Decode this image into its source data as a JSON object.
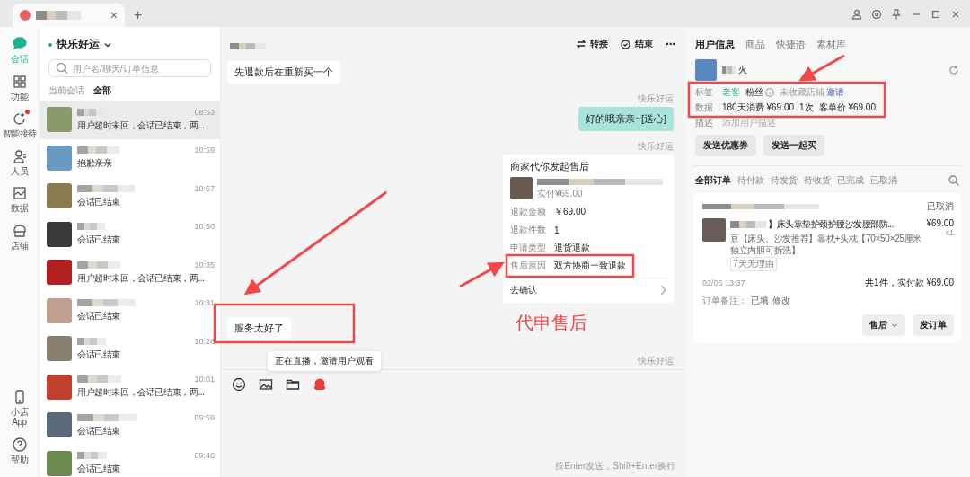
{
  "title_bar": {
    "tab": {
      "close": "×"
    },
    "new_tab": "+"
  },
  "nav": {
    "items": [
      {
        "label": "会话",
        "selected": true,
        "badge": false
      },
      {
        "label": "功能",
        "selected": false,
        "badge": false
      },
      {
        "label": "智能接待",
        "selected": false,
        "badge": true
      },
      {
        "label": "人员",
        "selected": false,
        "badge": false
      },
      {
        "label": "数据",
        "selected": false,
        "badge": false
      },
      {
        "label": "店铺",
        "selected": false,
        "badge": false
      }
    ],
    "bottom": [
      {
        "label": "小店\nApp"
      },
      {
        "label": "帮助"
      }
    ]
  },
  "conversations": {
    "shop_name": "快乐好运",
    "online": true,
    "search": {
      "placeholder": "用户名/聊天/订单信息"
    },
    "filters": [
      {
        "label": "当前会话",
        "selected": false
      },
      {
        "label": "全部",
        "selected": true
      }
    ],
    "items": [
      {
        "time": "08:53",
        "preview": "用户超时未回，会话已结束，两...",
        "selected": true
      },
      {
        "time": "10:59",
        "preview": "抱歉亲亲",
        "selected": false
      },
      {
        "time": "10:57",
        "preview": "会话已结束",
        "selected": false
      },
      {
        "time": "10:50",
        "preview": "会话已结束",
        "selected": false
      },
      {
        "time": "10:35",
        "preview": "用户超时未回，会话已结束，两...",
        "selected": false
      },
      {
        "time": "10:31",
        "preview": "会话已结束",
        "selected": false
      },
      {
        "time": "10:28",
        "preview": "会话已结束",
        "selected": false
      },
      {
        "time": "10:01",
        "preview": "用户超时未回，会话已结束，两...",
        "selected": false
      },
      {
        "time": "09:59",
        "preview": "会话已结束",
        "selected": false
      },
      {
        "time": "09:48",
        "preview": "会话已结束",
        "selected": false
      }
    ]
  },
  "chat": {
    "actions": [
      "转接",
      "结束"
    ],
    "more": "···",
    "messages": [
      {
        "kind": "incoming",
        "text": "先退款后在重新买一个"
      },
      {
        "kind": "outgoing",
        "sender": "快乐好运",
        "text": "好的哦亲亲~[送心]"
      },
      {
        "kind": "card",
        "sender": "快乐好运",
        "title": "商家代你发起售后",
        "paid": "实付¥69.00",
        "fields": [
          {
            "label": "退款金额",
            "value": "￥69.00"
          },
          {
            "label": "退款件数",
            "value": "1"
          },
          {
            "label": "申请类型",
            "value": "退货退款"
          },
          {
            "label": "售后原因",
            "value": "双方协商一致退款"
          }
        ],
        "action": "去确认"
      },
      {
        "kind": "incoming",
        "text": "服务太好了"
      },
      {
        "kind": "sender",
        "sender": "快乐好运"
      }
    ],
    "tooltip": "正在直播，邀请用户观看",
    "hint": "按Enter发送，Shift+Enter换行"
  },
  "user_panel": {
    "tabs": [
      {
        "label": "用户信息",
        "selected": true
      },
      {
        "label": "商品",
        "selected": false
      },
      {
        "label": "快捷语",
        "selected": false
      },
      {
        "label": "素材库",
        "selected": false
      }
    ],
    "name_suffix": "火",
    "tags_label": "标签",
    "tags": [
      {
        "text": "老客",
        "kind": "highlight"
      },
      {
        "text": "粉丝",
        "kind": "info"
      },
      {
        "text": "未收藏店铺",
        "kind": "muted"
      },
      {
        "text": "邀请",
        "kind": "link"
      }
    ],
    "data_label": "数据",
    "data": [
      "180天消费 ¥69.00",
      "1次",
      "客单价 ¥69.00"
    ],
    "desc_label": "描述",
    "desc_placeholder": "添加用户描述",
    "buttons": [
      "发送优惠券",
      "发送一起买"
    ],
    "order_tabs": [
      {
        "label": "全部订单",
        "selected": true
      },
      {
        "label": "待付款",
        "selected": false
      },
      {
        "label": "待发货",
        "selected": false
      },
      {
        "label": "待收货",
        "selected": false
      },
      {
        "label": "已完成",
        "selected": false
      },
      {
        "label": "已取消",
        "selected": false
      }
    ],
    "order": {
      "status": "已取消",
      "title": "】床头靠垫护颈护腰沙发腰部防...",
      "price": "¥69.00",
      "qty": "x1",
      "spec": "豆【床头、沙发推荐】靠枕+头枕【70×50×25厘米独立内胆可拆洗】",
      "badge": "7天无理由",
      "time": "02/05 13:37",
      "total": "共1件，实付款 ¥69.00",
      "note_label": "订单备注：",
      "note_value": "已填",
      "note_edit": "修改",
      "buttons": [
        {
          "label": "售后",
          "dropdown": true
        },
        {
          "label": "发订单",
          "dropdown": false
        }
      ]
    }
  },
  "annotations": {
    "caption": "代申售后"
  }
}
